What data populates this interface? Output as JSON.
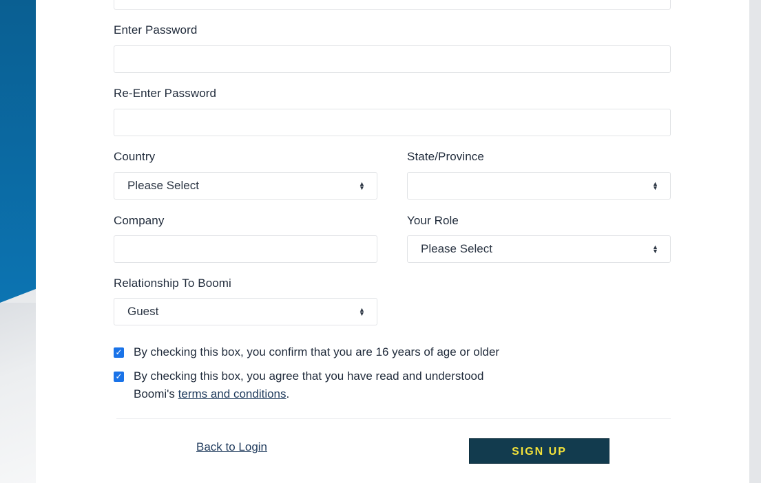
{
  "form": {
    "password_label": "Enter Password",
    "password_value": "",
    "reenter_label": "Re-Enter Password",
    "reenter_value": "",
    "country_label": "Country",
    "country_value": "Please Select",
    "state_label": "State/Province",
    "state_value": "",
    "company_label": "Company",
    "company_value": "",
    "role_label": "Your Role",
    "role_value": "Please Select",
    "relationship_label": "Relationship To Boomi",
    "relationship_value": "Guest"
  },
  "consent": {
    "age_text": "By checking this box, you confirm that you are 16 years of age or older",
    "age_checked": true,
    "terms_text_line1": "By checking this box, you agree that you have read and understood",
    "terms_text_prefix": "Boomi's ",
    "terms_link": "terms and conditions",
    "terms_text_suffix": ".",
    "terms_checked": true
  },
  "actions": {
    "back_label": "Back to Login",
    "signup_label": "SIGN UP"
  },
  "colors": {
    "accent_blue": "#0b6aa3",
    "checkbox_blue": "#1a73e8",
    "button_bg": "#123b4e",
    "button_text": "#f4e33a"
  },
  "icons": {
    "select_arrow": "sort-arrows-icon",
    "checkbox_mark": "checkmark-icon"
  }
}
